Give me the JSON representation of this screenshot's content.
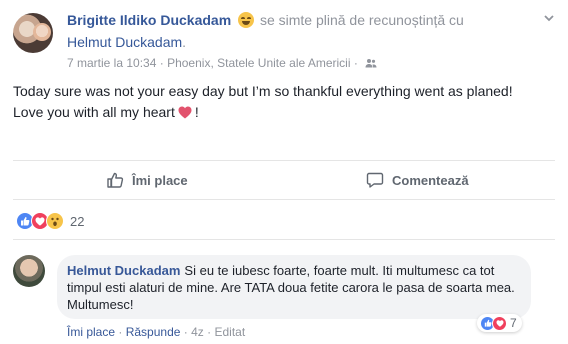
{
  "post": {
    "author": "Brigitte Ildiko Duckadam",
    "feeling_text": "se simte plină de recunoștință cu",
    "tagged_user": "Helmut Duckadam",
    "tagged_suffix": ".",
    "timestamp": "7 martie la 10:34",
    "separator": "·",
    "location": "Phoenix, Statele Unite ale Americii",
    "separator2": "·",
    "privacy_icon": "friends-icon",
    "menu_icon": "chevron-down-icon",
    "text_line1": "Today sure was not your easy day but I’m so thankful everything went as planed!",
    "text_line2_before": "Love you with all my heart",
    "text_line2_after": "!",
    "heart_icon": "heart-emoji-icon"
  },
  "actions": {
    "like_label": "Îmi place",
    "comment_label": "Comentează"
  },
  "reactions": {
    "icons": [
      "like-reaction-icon",
      "love-reaction-icon",
      "wow-reaction-icon"
    ],
    "count": "22"
  },
  "comment": {
    "author": "Helmut Duckadam",
    "text": "Si eu te iubesc foarte, foarte mult. Iti multumesc ca tot timpul esti alaturi de mine. Are TATA doua fetite carora le pasa de soarta mea. Multumesc!",
    "like_label": "Îmi place",
    "reply_label": "Răspunde",
    "time": "4z",
    "edited": "Editat",
    "dot": "·",
    "reaction_count": "7"
  },
  "colors": {
    "link": "#365899",
    "meta_gray": "#90949c",
    "like_blue": "#4e86f4",
    "love_red": "#f0405d",
    "wow_yellow": "#f7c44a"
  }
}
